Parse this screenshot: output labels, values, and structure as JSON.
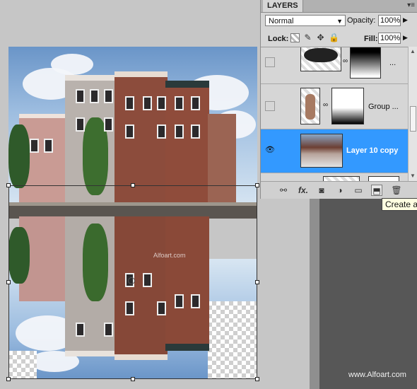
{
  "layers_panel": {
    "tab_label": "LAYERS",
    "blend_mode": "Normal",
    "opacity_label": "Opacity:",
    "opacity_value": "100%",
    "lock_label": "Lock:",
    "fill_label": "Fill:",
    "fill_value": "100%",
    "layers": [
      {
        "name": "...",
        "visible": false,
        "selected": false
      },
      {
        "name": "Group ...",
        "visible": false,
        "selected": false
      },
      {
        "name": "Layer 10 copy",
        "visible": true,
        "selected": true
      },
      {
        "name": "",
        "visible": false,
        "selected": false
      }
    ],
    "footer_icons": [
      "link-icon",
      "fx-icon",
      "mask-icon",
      "adjustment-icon",
      "folder-icon",
      "new-layer-icon",
      "trash-icon"
    ],
    "fx_label": "fx."
  },
  "tooltip": "Create a",
  "canvas_text": "Alfoart.com",
  "watermark": "www.Alfoart.com",
  "colors": {
    "selection_blue": "#3399ff",
    "panel_bg": "#d6d6d6",
    "canvas_bg": "#c6c6c6"
  }
}
